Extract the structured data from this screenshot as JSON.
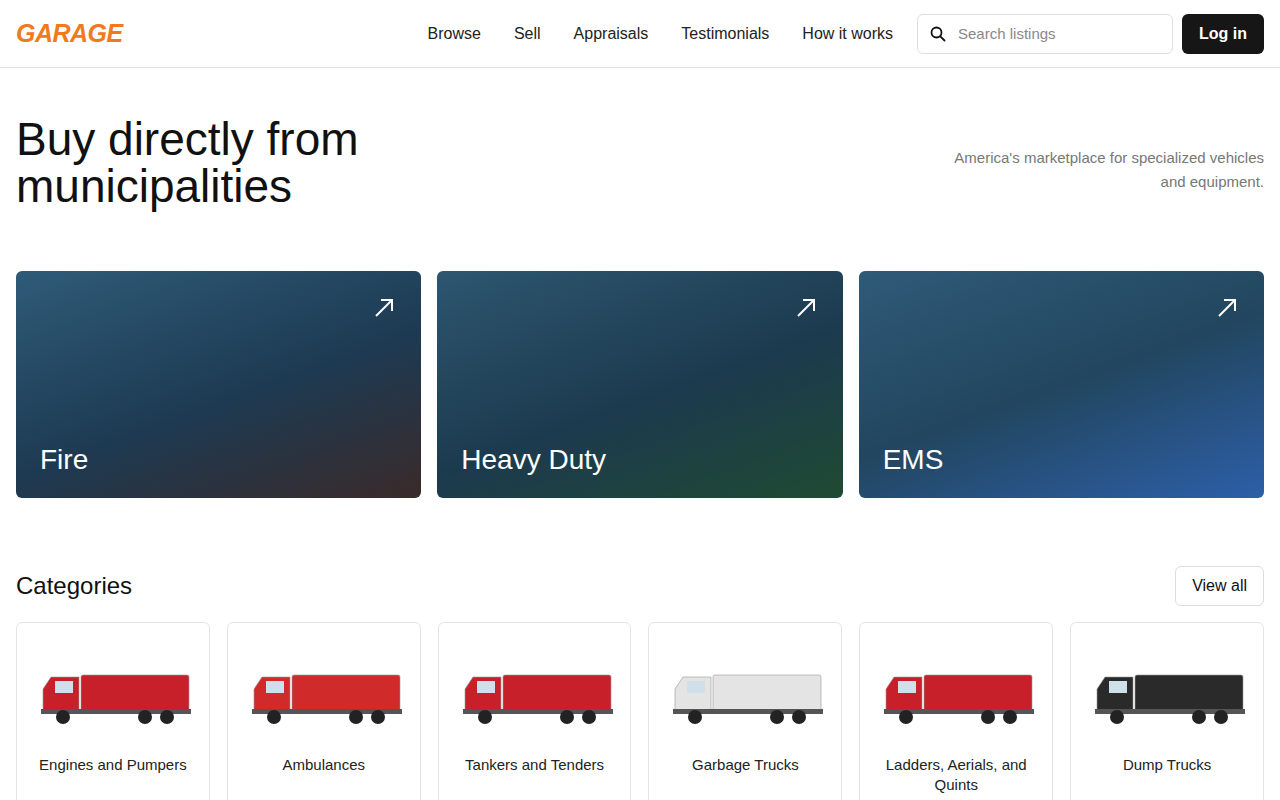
{
  "logo": "GARAGE",
  "nav": [
    {
      "label": "Browse"
    },
    {
      "label": "Sell"
    },
    {
      "label": "Appraisals"
    },
    {
      "label": "Testimonials"
    },
    {
      "label": "How it works"
    }
  ],
  "search": {
    "placeholder": "Search listings"
  },
  "login": "Log in",
  "hero": {
    "title": "Buy directly from municipalities",
    "tagline": "America's marketplace for specialized vehicles and equipment."
  },
  "featured": [
    {
      "label": "Fire"
    },
    {
      "label": "Heavy Duty"
    },
    {
      "label": "EMS"
    }
  ],
  "categories": {
    "title": "Categories",
    "view_all": "View all",
    "items": [
      {
        "label": "Engines and Pumpers",
        "color": "#c8202a"
      },
      {
        "label": "Ambulances",
        "color": "#d02a2a"
      },
      {
        "label": "Tankers and Tenders",
        "color": "#c8202a"
      },
      {
        "label": "Garbage Trucks",
        "color": "#e4e4e4"
      },
      {
        "label": "Ladders, Aerials, and Quints",
        "color": "#c8202a"
      },
      {
        "label": "Dump Trucks",
        "color": "#2a2a2a"
      }
    ]
  }
}
